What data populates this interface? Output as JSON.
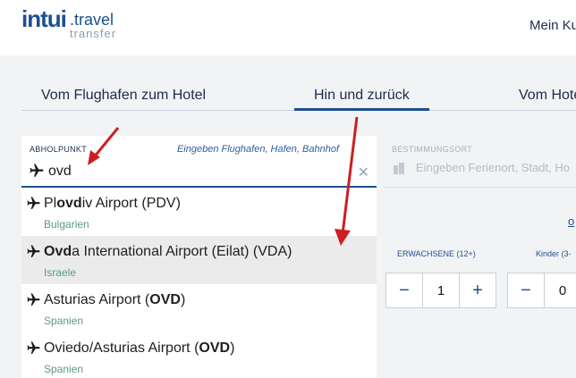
{
  "header": {
    "logo_intui": "intui",
    "logo_travel": ".travel",
    "logo_transfer": "transfer",
    "account_link": "Mein Ku"
  },
  "tabs": [
    {
      "label": "Vom Flughafen zum Hotel",
      "active": false
    },
    {
      "label": "Hin und zurück",
      "active": true
    },
    {
      "label": "Vom Hote",
      "active": false
    }
  ],
  "from": {
    "label": "ABHOLPUNKT",
    "hint": "Eingeben Flughafen, Hafen, Bahnhof",
    "value": "ovd",
    "icon": "plane-icon",
    "clear_icon": "close-icon"
  },
  "to": {
    "label": "BESTIMMUNGSORT",
    "placeholder": "Eingeben Ferienort, Stadt, Ho",
    "icon": "building-icon"
  },
  "link_o": "o",
  "passengers": {
    "adults_label": "ERWACHSENE (12+)",
    "adults_value": "1",
    "children_label": "Kinder (3-",
    "children_value": "0",
    "minus": "−",
    "plus": "+"
  },
  "suggestions": [
    {
      "pre": "Pl",
      "bold": "ovd",
      "post": "iv Airport (PDV)",
      "country": "Bulgarien",
      "highlighted": false
    },
    {
      "pre": "",
      "bold": "Ovd",
      "post": "a International Airport (Eilat) (VDA)",
      "country": "Israele",
      "highlighted": true
    },
    {
      "pre": "Asturias Airport (",
      "bold": "OVD",
      "post": ")",
      "country": "Spanien",
      "highlighted": false
    },
    {
      "pre": "Oviedo/Asturias Airport (",
      "bold": "OVD",
      "post": ")",
      "country": "Spanien",
      "highlighted": false
    }
  ],
  "colors": {
    "brand": "#1d4f91",
    "arrow": "#cc1f1f",
    "country": "#5a9a86"
  }
}
